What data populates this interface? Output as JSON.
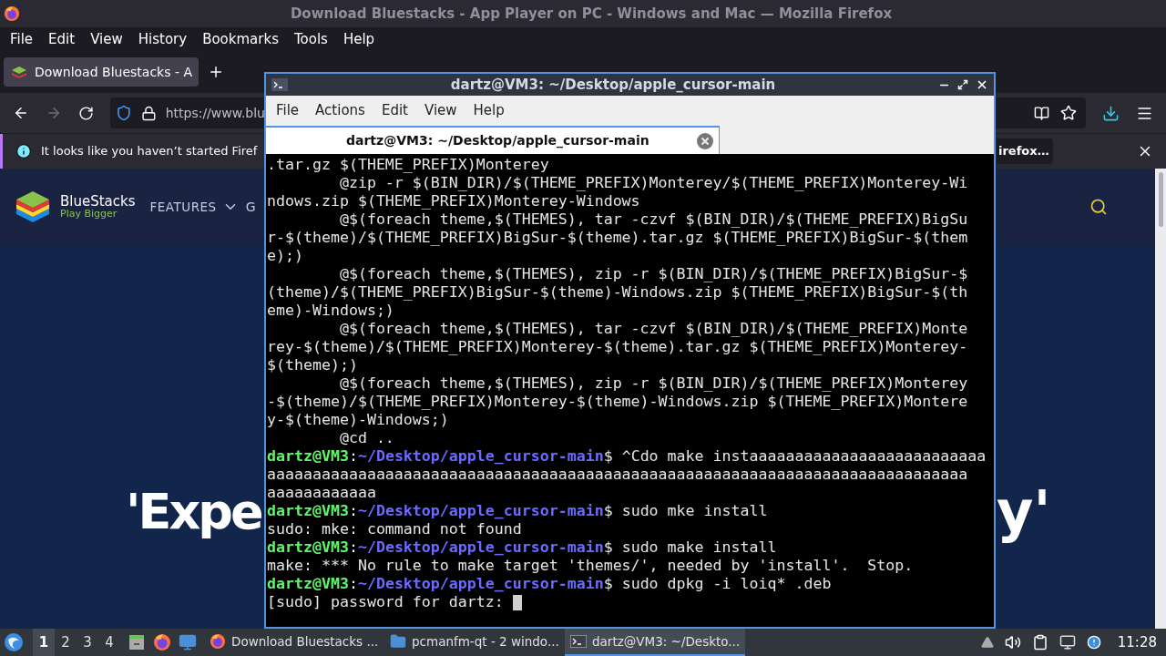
{
  "firefox": {
    "title": "Download Bluestacks - App Player on PC - Windows and Mac — Mozilla Firefox",
    "menu": [
      "File",
      "Edit",
      "View",
      "History",
      "Bookmarks",
      "Tools",
      "Help"
    ],
    "tab": {
      "title": "Download Bluestacks - A",
      "selected": true
    },
    "address": "https://www.blu",
    "notification": {
      "text": "It looks like you haven’t started Firef",
      "button": "irefox…"
    },
    "site": {
      "brand": "BlueStacks",
      "tagline": "Play Bigger",
      "nav": [
        "FEATURES",
        "G"
      ],
      "headline_left": "'Expe",
      "headline_right": "y'"
    }
  },
  "terminal": {
    "title": "dartz@VM3: ~/Desktop/apple_cursor-main",
    "menu": [
      "File",
      "Actions",
      "Edit",
      "View",
      "Help"
    ],
    "tab": {
      "title": "dartz@VM3: ~/Desktop/apple_cursor-main",
      "selected": true
    },
    "lines": [
      {
        "kind": "output",
        "text": ".tar.gz $(THEME_PREFIX)Monterey"
      },
      {
        "kind": "output",
        "text": "        @zip -r $(BIN_DIR)/$(THEME_PREFIX)Monterey/$(THEME_PREFIX)Monterey-Wi"
      },
      {
        "kind": "output",
        "text": "ndows.zip $(THEME_PREFIX)Monterey-Windows"
      },
      {
        "kind": "output",
        "text": "        @$(foreach theme,$(THEMES), tar -czvf $(BIN_DIR)/$(THEME_PREFIX)BigSu"
      },
      {
        "kind": "output",
        "text": "r-$(theme)/$(THEME_PREFIX)BigSur-$(theme).tar.gz $(THEME_PREFIX)BigSur-$(them"
      },
      {
        "kind": "output",
        "text": "e);)"
      },
      {
        "kind": "output",
        "text": "        @$(foreach theme,$(THEMES), zip -r $(BIN_DIR)/$(THEME_PREFIX)BigSur-$"
      },
      {
        "kind": "output",
        "text": "(theme)/$(THEME_PREFIX)BigSur-$(theme)-Windows.zip $(THEME_PREFIX)BigSur-$(th"
      },
      {
        "kind": "output",
        "text": "eme)-Windows;)"
      },
      {
        "kind": "output",
        "text": "        @$(foreach theme,$(THEMES), tar -czvf $(BIN_DIR)/$(THEME_PREFIX)Monte"
      },
      {
        "kind": "output",
        "text": "rey-$(theme)/$(THEME_PREFIX)Monterey-$(theme).tar.gz $(THEME_PREFIX)Monterey-"
      },
      {
        "kind": "output",
        "text": "$(theme);)"
      },
      {
        "kind": "output",
        "text": "        @$(foreach theme,$(THEMES), zip -r $(BIN_DIR)/$(THEME_PREFIX)Monterey"
      },
      {
        "kind": "output",
        "text": "-$(theme)/$(THEME_PREFIX)Monterey-$(theme)-Windows.zip $(THEME_PREFIX)Montere"
      },
      {
        "kind": "output",
        "text": "y-$(theme)-Windows;)"
      },
      {
        "kind": "output",
        "text": "        @cd .."
      },
      {
        "kind": "prompt",
        "user": "dartz@VM3",
        "separator": ":",
        "path": "~/Desktop/apple_cursor-main",
        "command": "$ ^Cdo make instaaaaaaaaaaaaaaaaaaaaaaaaaa"
      },
      {
        "kind": "output",
        "text": "aaaaaaaaaaaaaaaaaaaaaaaaaaaaaaaaaaaaaaaaaaaaaaaaaaaaaaaaaaaaaaaaaaaaaaaaaaaaa"
      },
      {
        "kind": "output",
        "text": "aaaaaaaaaaaa"
      },
      {
        "kind": "prompt",
        "user": "dartz@VM3",
        "separator": ":",
        "path": "~/Desktop/apple_cursor-main",
        "command": "$ sudo mke install"
      },
      {
        "kind": "output",
        "text": "sudo: mke: command not found"
      },
      {
        "kind": "prompt",
        "user": "dartz@VM3",
        "separator": ":",
        "path": "~/Desktop/apple_cursor-main",
        "command": "$ sudo make install"
      },
      {
        "kind": "output",
        "text": "make: *** No rule to make target 'themes/', needed by 'install'.  Stop."
      },
      {
        "kind": "prompt",
        "user": "dartz@VM3",
        "separator": ":",
        "path": "~/Desktop/apple_cursor-main",
        "command": "$ sudo dpkg -i loiq* .deb"
      },
      {
        "kind": "input",
        "text": "[sudo] password for dartz: ",
        "cursor": true
      }
    ]
  },
  "taskbar": {
    "workspaces": [
      {
        "label": "1",
        "selected": true
      },
      {
        "label": "2",
        "selected": false
      },
      {
        "label": "3",
        "selected": false
      },
      {
        "label": "4",
        "selected": false
      }
    ],
    "tasks": [
      {
        "kind": "browser",
        "label": "Download Bluestacks ...",
        "selected": false
      },
      {
        "kind": "folder",
        "label": "pcmanfm-qt - 2 windo...",
        "selected": false
      },
      {
        "kind": "terminal",
        "label": "dartz@VM3: ~/Deskto...",
        "selected": true
      }
    ],
    "clock": "11:28"
  }
}
